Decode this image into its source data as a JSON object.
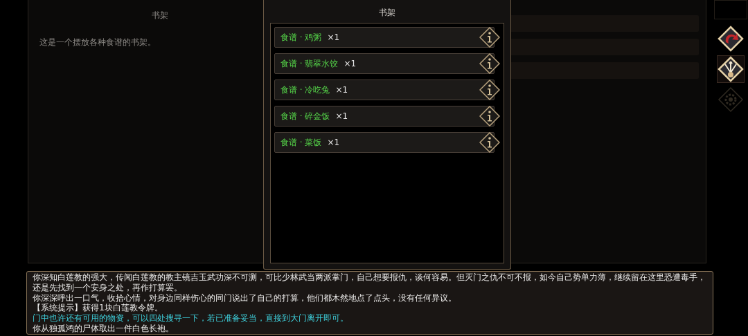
{
  "background_panel": {
    "title": "书架",
    "description": "这是一个摆放各种食谱的书架。"
  },
  "modal": {
    "title": "书架",
    "items": [
      {
        "name": "食谱 · 鸡粥",
        "count": "×1"
      },
      {
        "name": "食谱 · 翡翠水饺",
        "count": "×1"
      },
      {
        "name": "食谱 · 冷吃兔",
        "count": "×1"
      },
      {
        "name": "食谱 · 碎金饭",
        "count": "×1"
      },
      {
        "name": "食谱 · 菜饭",
        "count": "×1"
      }
    ]
  },
  "sidebar": {
    "buttons": [
      {
        "kind": "redirect",
        "selected": false,
        "disabled": false
      },
      {
        "kind": "trident",
        "selected": true,
        "disabled": false
      },
      {
        "kind": "gear",
        "selected": false,
        "disabled": true
      }
    ]
  },
  "log": [
    {
      "kind": "normal",
      "text": "你深知白莲教的强大，传闻白莲教的教主镜吉玉武功深不可测，可比少林武当两派掌门，自己想要报仇，谈何容易。但灭门之仇不可不报，如今自己势单力薄，继续留在这里恐遭毒手，还是先找到一个安身之处，再作打算罢。"
    },
    {
      "kind": "normal",
      "text": "你深深呼出一口气，收拾心情，对身边同样伤心的同门说出了自己的打算，他们都木然地点了点头，没有任何异议。"
    },
    {
      "kind": "normal",
      "text": "【系统提示】获得1块白莲教令牌。"
    },
    {
      "kind": "hint",
      "text": "门中也许还有可用的物资，可以四处搜寻一下，若已准备妥当，直接到大门离开即可。"
    },
    {
      "kind": "normal",
      "text": "你从独孤鸿的尸体取出一件白色长袍。"
    }
  ]
}
